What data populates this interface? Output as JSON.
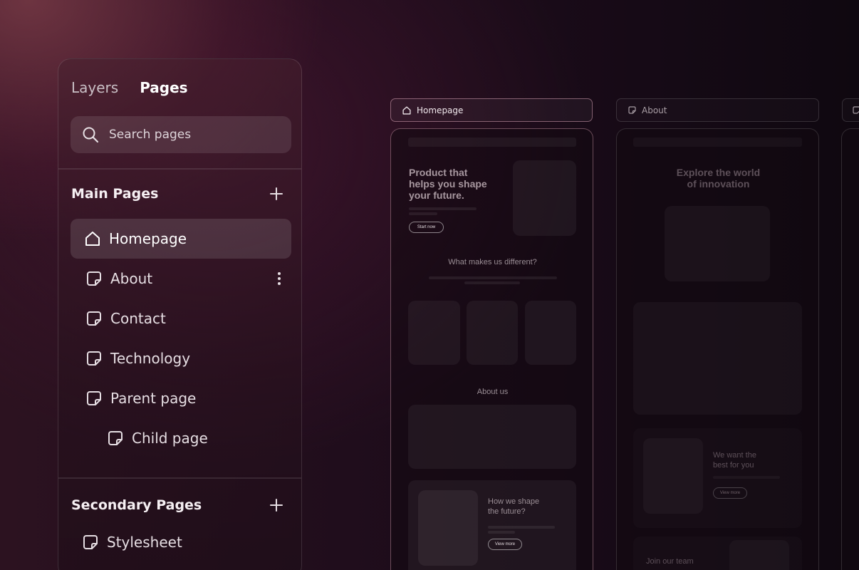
{
  "sidebar": {
    "tabs": [
      {
        "label": "Layers",
        "active": false
      },
      {
        "label": "Pages",
        "active": true
      }
    ],
    "search": {
      "placeholder": "Search pages"
    },
    "main_section": {
      "title": "Main Pages",
      "items": [
        {
          "label": "Homepage",
          "icon": "home-icon"
        },
        {
          "label": "About",
          "icon": "page-icon"
        },
        {
          "label": "Contact",
          "icon": "page-icon"
        },
        {
          "label": "Technology",
          "icon": "page-icon"
        },
        {
          "label": "Parent page",
          "icon": "page-icon"
        },
        {
          "label": "Child page",
          "icon": "page-icon"
        }
      ]
    },
    "secondary_section": {
      "title": "Secondary Pages",
      "items": [
        {
          "label": "Stylesheet",
          "icon": "page-icon"
        }
      ]
    }
  },
  "canvas": {
    "pages": [
      {
        "label": "Homepage",
        "icon": "home-icon"
      },
      {
        "label": "About",
        "icon": "page-icon"
      }
    ],
    "homepage": {
      "hero_heading": [
        "Product that",
        "helps you shape",
        "your future."
      ],
      "hero_button": "Start now",
      "section_heading": "What makes us different?",
      "about_heading": "About us",
      "feature_heading": [
        "How we shape",
        "the future?"
      ],
      "feature_button": "View more"
    },
    "about": {
      "hero_heading": [
        "Explore the world",
        "of innovation"
      ],
      "feature_heading": [
        "We want the",
        "best for you"
      ],
      "feature_button": "View more",
      "team_heading": "Join our team"
    }
  },
  "colors": {
    "accent_border": "#d6a0b2",
    "text_primary": "#ffffff",
    "text_secondary": "#c9bfc5"
  }
}
